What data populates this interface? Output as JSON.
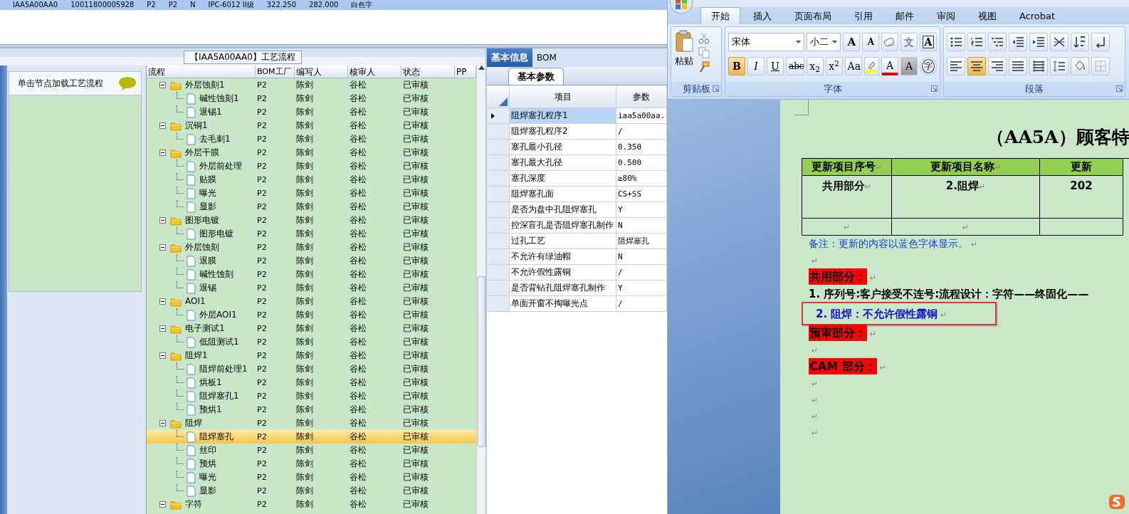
{
  "top_row": {
    "cells": [
      "IAA5A00AA0",
      "10011800005928",
      "P2",
      "P2",
      "N",
      "IPC-6012 II级",
      "322.250",
      "282.000",
      "白色字"
    ]
  },
  "flow_panel": {
    "caption": "【IAA5A00AA0】工艺流程",
    "hint": "单击节点加载工艺流程"
  },
  "tree": {
    "columns": [
      "流程",
      "BOM工厂",
      "编写人",
      "核审人",
      "状态",
      "PP"
    ],
    "nodes": [
      {
        "kind": "folder",
        "name": "外层蚀刻1",
        "bom": "P2",
        "author": "陈剑",
        "reviewer": "谷松",
        "status": "已审核",
        "expanded": true,
        "selected": false,
        "children": [
          {
            "kind": "step",
            "name": "碱性蚀刻1",
            "bom": "P2",
            "author": "陈剑",
            "reviewer": "谷松",
            "status": "已审核",
            "selected": false
          },
          {
            "kind": "step",
            "name": "退锡1",
            "bom": "P2",
            "author": "陈剑",
            "reviewer": "谷松",
            "status": "已审核",
            "selected": false
          }
        ]
      },
      {
        "kind": "folder",
        "name": "沉铜1",
        "bom": "P2",
        "author": "陈剑",
        "reviewer": "谷松",
        "status": "已审核",
        "expanded": true,
        "selected": false,
        "children": [
          {
            "kind": "step",
            "name": "去毛刺1",
            "bom": "P2",
            "author": "陈剑",
            "reviewer": "谷松",
            "status": "已审核",
            "selected": false
          }
        ]
      },
      {
        "kind": "folder",
        "name": "外层干膜",
        "bom": "P2",
        "author": "陈剑",
        "reviewer": "谷松",
        "status": "已审核",
        "expanded": true,
        "selected": false,
        "children": [
          {
            "kind": "step",
            "name": "外层前处理",
            "bom": "P2",
            "author": "陈剑",
            "reviewer": "谷松",
            "status": "已审核",
            "selected": false
          },
          {
            "kind": "step",
            "name": "贴膜",
            "bom": "P2",
            "author": "陈剑",
            "reviewer": "谷松",
            "status": "已审核",
            "selected": false
          },
          {
            "kind": "step",
            "name": "曝光",
            "bom": "P2",
            "author": "陈剑",
            "reviewer": "谷松",
            "status": "已审核",
            "selected": false
          },
          {
            "kind": "step",
            "name": "显影",
            "bom": "P2",
            "author": "陈剑",
            "reviewer": "谷松",
            "status": "已审核",
            "selected": false
          }
        ]
      },
      {
        "kind": "folder",
        "name": "图形电镀",
        "bom": "P2",
        "author": "陈剑",
        "reviewer": "谷松",
        "status": "已审核",
        "expanded": true,
        "selected": false,
        "children": [
          {
            "kind": "step",
            "name": "图形电镀",
            "bom": "P2",
            "author": "陈剑",
            "reviewer": "谷松",
            "status": "已审核",
            "selected": false
          }
        ]
      },
      {
        "kind": "folder",
        "name": "外层蚀刻",
        "bom": "P2",
        "author": "陈剑",
        "reviewer": "谷松",
        "status": "已审核",
        "expanded": true,
        "selected": false,
        "children": [
          {
            "kind": "step",
            "name": "退膜",
            "bom": "P2",
            "author": "陈剑",
            "reviewer": "谷松",
            "status": "已审核",
            "selected": false
          },
          {
            "kind": "step",
            "name": "碱性蚀刻",
            "bom": "P2",
            "author": "陈剑",
            "reviewer": "谷松",
            "status": "已审核",
            "selected": false
          },
          {
            "kind": "step",
            "name": "退锡",
            "bom": "P2",
            "author": "陈剑",
            "reviewer": "谷松",
            "status": "已审核",
            "selected": false
          }
        ]
      },
      {
        "kind": "folder",
        "name": "AOI1",
        "bom": "P2",
        "author": "陈剑",
        "reviewer": "谷松",
        "status": "已审核",
        "expanded": true,
        "selected": false,
        "children": [
          {
            "kind": "step",
            "name": "外层AOI1",
            "bom": "P2",
            "author": "陈剑",
            "reviewer": "谷松",
            "status": "已审核",
            "selected": false
          }
        ]
      },
      {
        "kind": "folder",
        "name": "电子测试1",
        "bom": "P2",
        "author": "陈剑",
        "reviewer": "谷松",
        "status": "已审核",
        "expanded": true,
        "selected": false,
        "children": [
          {
            "kind": "step",
            "name": "低阻测试1",
            "bom": "P2",
            "author": "陈剑",
            "reviewer": "谷松",
            "status": "已审核",
            "selected": false
          }
        ]
      },
      {
        "kind": "folder",
        "name": "阻焊1",
        "bom": "P2",
        "author": "陈剑",
        "reviewer": "谷松",
        "status": "已审核",
        "expanded": true,
        "selected": false,
        "children": [
          {
            "kind": "step",
            "name": "阻焊前处理1",
            "bom": "P2",
            "author": "陈剑",
            "reviewer": "谷松",
            "status": "已审核",
            "selected": false
          },
          {
            "kind": "step",
            "name": "烘板1",
            "bom": "P2",
            "author": "陈剑",
            "reviewer": "谷松",
            "status": "已审核",
            "selected": false
          },
          {
            "kind": "step",
            "name": "阻焊塞孔1",
            "bom": "P2",
            "author": "陈剑",
            "reviewer": "谷松",
            "status": "已审核",
            "selected": false
          },
          {
            "kind": "step",
            "name": "预烘1",
            "bom": "P2",
            "author": "陈剑",
            "reviewer": "谷松",
            "status": "已审核",
            "selected": false
          }
        ]
      },
      {
        "kind": "folder",
        "name": "阻焊",
        "bom": "P2",
        "author": "陈剑",
        "reviewer": "谷松",
        "status": "已审核",
        "expanded": true,
        "selected": false,
        "children": [
          {
            "kind": "step",
            "name": "阻焊塞孔",
            "bom": "P2",
            "author": "陈剑",
            "reviewer": "谷松",
            "status": "已审核",
            "selected": true
          },
          {
            "kind": "step",
            "name": "丝印",
            "bom": "P2",
            "author": "陈剑",
            "reviewer": "谷松",
            "status": "已审核",
            "selected": false
          },
          {
            "kind": "step",
            "name": "预烘",
            "bom": "P2",
            "author": "陈剑",
            "reviewer": "谷松",
            "status": "已审核",
            "selected": false
          },
          {
            "kind": "step",
            "name": "曝光",
            "bom": "P2",
            "author": "陈剑",
            "reviewer": "谷松",
            "status": "已审核",
            "selected": false
          },
          {
            "kind": "step",
            "name": "显影",
            "bom": "P2",
            "author": "陈剑",
            "reviewer": "谷松",
            "status": "已审核",
            "selected": false
          }
        ]
      },
      {
        "kind": "folder",
        "name": "字符",
        "bom": "P2",
        "author": "陈剑",
        "reviewer": "谷松",
        "status": "已审核",
        "expanded": true,
        "selected": false
      }
    ]
  },
  "info_panel": {
    "tabs": [
      {
        "label": "基本信息",
        "selected": true
      },
      {
        "label": "BOM",
        "selected": false
      }
    ],
    "subtabs": [
      {
        "label": "基本参数",
        "selected": true
      }
    ],
    "columns": [
      "项目",
      "参数"
    ],
    "rows": [
      {
        "item": "阻焊塞孔程序1",
        "value": "iaa5a00aa.",
        "selected": true
      },
      {
        "item": "阻焊塞孔程序2",
        "value": "/",
        "selected": false
      },
      {
        "item": "塞孔最小孔径",
        "value": "0.350",
        "selected": false
      },
      {
        "item": "塞孔最大孔径",
        "value": "0.500",
        "selected": false
      },
      {
        "item": "塞孔深度",
        "value": "≥80%",
        "selected": false
      },
      {
        "item": "阻焊塞孔面",
        "value": "CS+SS",
        "selected": false
      },
      {
        "item": "是否为盘中孔阻焊塞孔",
        "value": "Y",
        "selected": false
      },
      {
        "item": "控深盲孔是否阻焊塞孔制作",
        "value": "N",
        "selected": false
      },
      {
        "item": "过孔工艺",
        "value": "阻焊塞孔",
        "selected": false
      },
      {
        "item": "不允许有绿油帽",
        "value": "N",
        "selected": false
      },
      {
        "item": "不允许假性露铜",
        "value": "/",
        "selected": false
      },
      {
        "item": "是否背钻孔阻焊塞孔制作",
        "value": "Y",
        "selected": false
      },
      {
        "item": "单面开窗不掏曝光点",
        "value": "/",
        "selected": false
      }
    ]
  },
  "word": {
    "tabs": [
      {
        "label": "开始",
        "selected": true
      },
      {
        "label": "插入",
        "selected": false
      },
      {
        "label": "页面布局",
        "selected": false
      },
      {
        "label": "引用",
        "selected": false
      },
      {
        "label": "邮件",
        "selected": false
      },
      {
        "label": "审阅",
        "selected": false
      },
      {
        "label": "视图",
        "selected": false
      },
      {
        "label": "Acrobat",
        "selected": false
      }
    ],
    "clipboard": {
      "paste": "粘贴",
      "label": "剪贴板"
    },
    "font": {
      "name": "宋体",
      "size": "小二",
      "label": "字体",
      "row1": [
        {
          "kind": "grow",
          "label": "A"
        },
        {
          "kind": "shrink",
          "label": "A"
        },
        {
          "kind": "clear"
        },
        {
          "kind": "phonetic",
          "label": "文"
        },
        {
          "kind": "border",
          "label": "A"
        }
      ],
      "row2": [
        {
          "kind": "bold",
          "label": "B",
          "on": true
        },
        {
          "kind": "italic",
          "label": "I",
          "on": false
        },
        {
          "kind": "underline",
          "label": "U",
          "on": false
        },
        {
          "kind": "strike",
          "label": "abc",
          "on": false
        },
        {
          "kind": "script",
          "label": "x$_{2}$",
          "on": false
        },
        {
          "kind": "script",
          "label": "x$^{2}$",
          "on": false
        },
        {
          "kind": "case",
          "label": "Aa",
          "on": false
        },
        {
          "kind": "highlight",
          "on": false
        },
        {
          "kind": "color",
          "label": "A",
          "on": false
        },
        {
          "kind": "shading",
          "label": "A",
          "on": false
        },
        {
          "kind": "enclose",
          "label": "字",
          "on": false
        }
      ]
    },
    "paragraph": {
      "label": "段落",
      "row1": [
        {
          "kind": "bullets"
        },
        {
          "kind": "numbering"
        },
        {
          "kind": "multilevel"
        },
        {
          "kind": "outdent"
        },
        {
          "kind": "indent"
        },
        {
          "kind": "asian"
        },
        {
          "kind": "sort"
        },
        {
          "kind": "marks"
        }
      ],
      "row2": [
        {
          "kind": "left",
          "on": false
        },
        {
          "kind": "center",
          "on": true
        },
        {
          "kind": "right",
          "on": false
        },
        {
          "kind": "justify",
          "on": false
        },
        {
          "kind": "distribute",
          "on": false
        },
        {
          "kind": "spacing",
          "on": false
        },
        {
          "kind": "fill",
          "on": false
        },
        {
          "kind": "borders",
          "on": false
        }
      ]
    },
    "document": {
      "title": "（AA5A）顾客特",
      "table": {
        "header": [
          {
            "text": "更新项目序号",
            "mark": "↵"
          },
          {
            "text": "更新项目名称",
            "mark": "↵"
          },
          {
            "text": "更新"
          }
        ],
        "rows": [
          [
            {
              "text": "共用部分",
              "mark": "↵"
            },
            {
              "text": "2.阻焊",
              "mark": "↵"
            },
            {
              "text": "202"
            }
          ],
          [
            {
              "mark": "↵"
            },
            {
              "mark": "↵"
            },
            {}
          ]
        ]
      },
      "paragraphs": [
        {
          "kind": "note",
          "text": "备注：更新的内容以蓝色字体显示。",
          "mark": "↵"
        },
        {
          "kind": "empty",
          "mark": "↵"
        },
        {
          "kind": "heading",
          "text": "共用部分：",
          "mark": "↵"
        },
        {
          "kind": "item",
          "text": "1.  序列号:客户接受不连号:流程设计：字符——终固化——"
        },
        {
          "kind": "changed",
          "text": "2.  阻焊：不允许假性露铜",
          "mark": "↵",
          "boxed": true
        },
        {
          "kind": "heading",
          "text": "预审部分：",
          "mark": "↵"
        },
        {
          "kind": "empty",
          "mark": "↵"
        },
        {
          "kind": "heading",
          "text": "CAM 部分：",
          "mark": "↵"
        },
        {
          "kind": "empty",
          "mark": "↵"
        },
        {
          "kind": "empty",
          "mark": "↵"
        },
        {
          "kind": "empty",
          "mark": "↵"
        },
        {
          "kind": "empty",
          "mark": "↵"
        }
      ]
    }
  }
}
